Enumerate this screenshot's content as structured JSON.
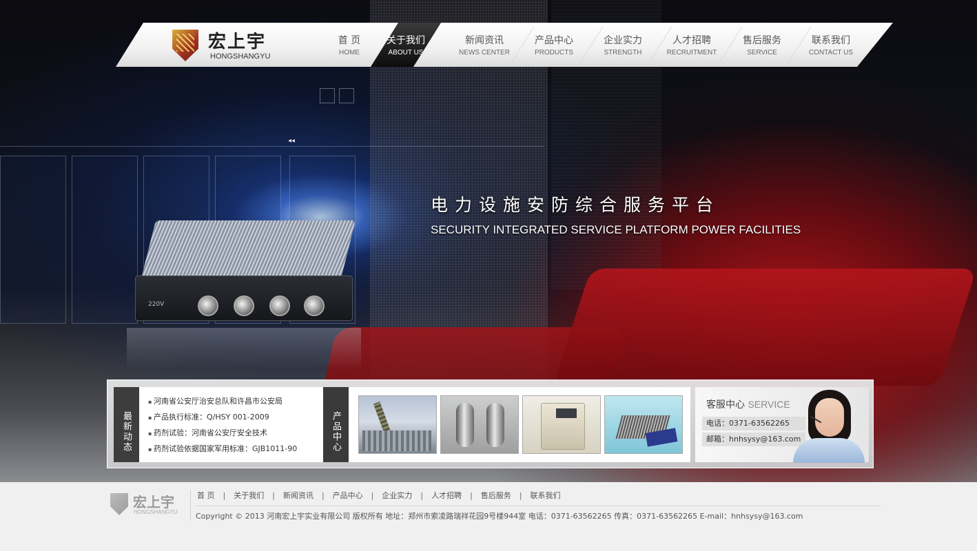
{
  "brand": {
    "name_cn": "宏上宇",
    "name_en": "HONGSHANGYU"
  },
  "nav": [
    {
      "cn": "首 页",
      "en": "HOME",
      "active": false
    },
    {
      "cn": "关于我们",
      "en": "ABOUT US",
      "active": true
    },
    {
      "cn": "新闻资讯",
      "en": "NEWS CENTER",
      "active": false
    },
    {
      "cn": "产品中心",
      "en": "PRODUCTS",
      "active": false
    },
    {
      "cn": "企业实力",
      "en": "STRENGTH",
      "active": false
    },
    {
      "cn": "人才招聘",
      "en": "RECRUITMENT",
      "active": false
    },
    {
      "cn": "售后服务",
      "en": "SERVICE",
      "active": false
    },
    {
      "cn": "联系我们",
      "en": "CONTACT US",
      "active": false
    }
  ],
  "hero": {
    "title": "电力设施安防综合服务平台",
    "subtitle": "SECURITY INTEGRATED SERVICE PLATFORM POWER FACILITIES",
    "device_label": "220V",
    "slider_control": "◂◂"
  },
  "news": {
    "tab_label": "最新动态",
    "items": [
      "河南省公安厅治安总队和许昌市公安局",
      "产品执行标准：Q/HSY 001-2009",
      "药剂试验：河南省公安厅安全技术",
      "药剂试验依据国家军用标准：GJB1011-90"
    ]
  },
  "products": {
    "tab_label": "产品中心"
  },
  "service": {
    "title_cn": "客服中心",
    "title_en": "SERVICE",
    "phone": "电话：0371-63562265",
    "email": "邮箱：hnhsysy@163.com"
  },
  "footer": {
    "links": [
      "首 页",
      "关于我们",
      "新闻资讯",
      "产品中心",
      "企业实力",
      "人才招聘",
      "售后服务",
      "联系我们"
    ],
    "copyright": "Copyright © 2013 河南宏上宇实业有限公司  版权所有   地址：郑州市索凌路瑞祥花园9号楼944室  电话：0371-63562265  传真：0371-63562265 E-mail：hnhsysy@163.com"
  }
}
